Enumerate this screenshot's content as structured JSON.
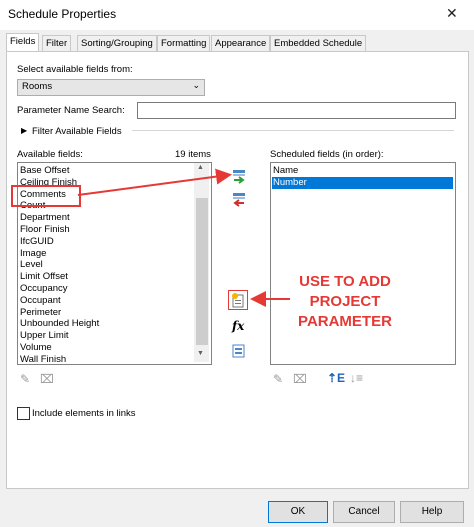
{
  "window": {
    "title": "Schedule Properties",
    "close_glyph": "✕"
  },
  "tabs": [
    {
      "label": "Fields",
      "active": true
    },
    {
      "label": "Filter"
    },
    {
      "label": "Sorting/Grouping"
    },
    {
      "label": "Formatting"
    },
    {
      "label": "Appearance"
    },
    {
      "label": "Embedded Schedule"
    }
  ],
  "fields_tab": {
    "select_label": "Select available fields from:",
    "select_value": "Rooms",
    "search_label": "Parameter Name Search:",
    "search_value": "",
    "filter_toggle": "Filter Available Fields",
    "available_label": "Available fields:",
    "available_count": "19 items",
    "available_fields": [
      "Base Offset",
      "Ceiling Finish",
      "Comments",
      "Count",
      "Department",
      "Floor Finish",
      "IfcGUID",
      "Image",
      "Level",
      "Limit Offset",
      "Occupancy",
      "Occupant",
      "Perimeter",
      "Unbounded Height",
      "Upper Limit",
      "Volume",
      "Wall Finish"
    ],
    "scheduled_label": "Scheduled fields (in order):",
    "scheduled_fields": [
      "Name",
      "Number"
    ],
    "scheduled_selected": "Number",
    "include_links_label": "Include elements in links",
    "include_links_checked": false
  },
  "annotation": {
    "text_lines": [
      "USE TO ADD",
      "PROJECT",
      "PARAMETER"
    ],
    "color": "#e53935"
  },
  "icons": {
    "add": "add-field-icon",
    "remove": "remove-field-icon",
    "add_parameter": "add-parameter-icon",
    "calculated": "fx-icon",
    "combine": "combine-parameters-icon",
    "edit": "edit-pencil-icon",
    "delete": "delete-icon",
    "move_up": "move-up-icon",
    "move_down": "move-down-icon"
  },
  "footer": {
    "ok": "OK",
    "cancel": "Cancel",
    "help": "Help"
  },
  "colors": {
    "selection": "#0078d7",
    "accent_red": "#e53935"
  }
}
